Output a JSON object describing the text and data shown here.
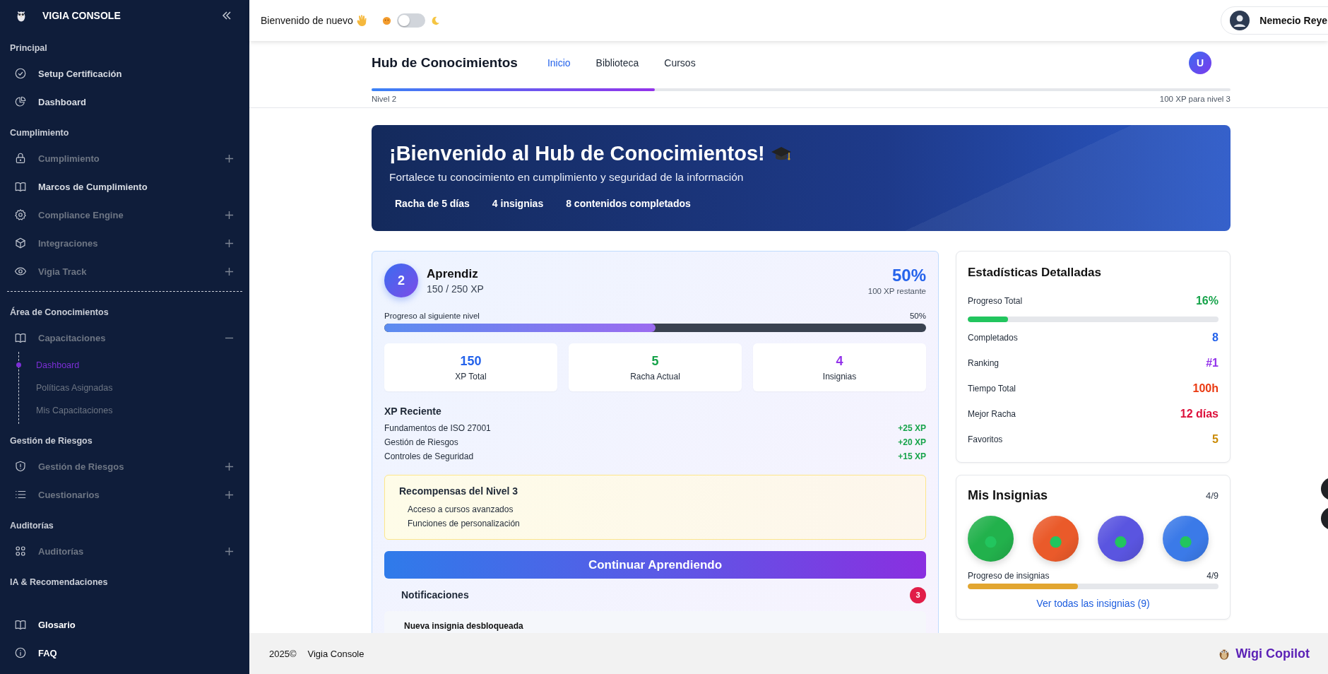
{
  "sidebar": {
    "brand": "VIGIA CONSOLE",
    "sections": [
      {
        "title": "Principal",
        "items": [
          {
            "label": "Setup Certificación"
          },
          {
            "label": "Dashboard"
          }
        ]
      },
      {
        "title": "Cumplimiento",
        "items": [
          {
            "label": "Cumplimiento",
            "expanded": false
          },
          {
            "label": "Marcos de Cumplimiento"
          },
          {
            "label": "Compliance Engine",
            "expanded": false
          },
          {
            "label": "Integraciones",
            "expanded": false
          },
          {
            "label": "Vigia Track",
            "expanded": false
          }
        ]
      },
      {
        "title": "Área de Conocimientos",
        "items": [
          {
            "label": "Capacitaciones",
            "expanded": true,
            "children": [
              {
                "label": "Dashboard",
                "selected": true
              },
              {
                "label": "Políticas Asignadas",
                "selected": false
              },
              {
                "label": "Mis Capacitaciones",
                "selected": false
              }
            ]
          }
        ]
      },
      {
        "title": "Gestión de Riesgos",
        "items": [
          {
            "label": "Gestión de Riesgos",
            "expanded": false
          },
          {
            "label": "Cuestionarios",
            "expanded": false
          }
        ]
      },
      {
        "title": "Auditorías",
        "items": [
          {
            "label": "Auditorías",
            "expanded": false
          }
        ]
      },
      {
        "title": "IA & Recomendaciones"
      }
    ],
    "bottom_links": [
      {
        "label": "Glosario"
      },
      {
        "label": "FAQ"
      }
    ]
  },
  "topbar": {
    "greeting": "Bienvenido de nuevo",
    "dark_mode": false,
    "user": "Nemecio Reye"
  },
  "hub": {
    "title": "Hub de Conocimientos",
    "tabs": [
      {
        "label": "Inicio",
        "selected": true
      },
      {
        "label": "Biblioteca",
        "selected": false
      },
      {
        "label": "Cursos",
        "selected": false
      }
    ],
    "avatar": "U",
    "progress": {
      "level": 0.33
    },
    "left_label": "Nivel 2",
    "right_label": "100 XP para nivel 3"
  },
  "banner": {
    "title": "¡Bienvenido al Hub de Conocimientos!",
    "subtitle": "Fortalece tu conocimiento en cumplimiento y seguridad de la información",
    "stats": [
      "Racha de 5 días",
      "4 insignias",
      "8 contenidos completados"
    ]
  },
  "level_card": {
    "level_number": "2",
    "rank": "Aprendiz",
    "xp": "150 / 250 XP",
    "percent": "50%",
    "remaining": "100 XP restante",
    "progress_label": "Progreso al siguiente nivel",
    "progress_reading": "50%",
    "progress": {
      "level": 0.5
    },
    "tiles": [
      {
        "value": "150",
        "label": "XP Total",
        "color": "#2563eb"
      },
      {
        "value": "5",
        "label": "Racha Actual",
        "color": "#16a34a"
      },
      {
        "value": "4",
        "label": "Insignias",
        "color": "#9333ea"
      }
    ],
    "recent_title": "XP Reciente",
    "recent": [
      {
        "name": "Fundamentos de ISO 27001",
        "xp": "+25 XP"
      },
      {
        "name": "Gestión de Riesgos",
        "xp": "+20 XP"
      },
      {
        "name": "Controles de Seguridad",
        "xp": "+15 XP"
      }
    ],
    "rewards": {
      "title": "Recompensas del Nivel 3",
      "items": [
        "Acceso a cursos avanzados",
        "Funciones de personalización"
      ]
    },
    "button": "Continuar Aprendiendo",
    "notifications": {
      "title": "Notificaciones",
      "count": "3",
      "items": [
        {
          "title": "Nueva insignia desbloqueada"
        }
      ]
    }
  },
  "stats_card": {
    "title": "Estadísticas Detalladas",
    "rows": [
      {
        "kind": "progress",
        "label": "Progreso Total",
        "value": "16%",
        "color": "#16a34a",
        "level": 0.16
      },
      {
        "kind": "count",
        "label": "Completados",
        "value": "8",
        "color": "#2563eb"
      },
      {
        "kind": "count",
        "label": "Ranking",
        "value": "#1",
        "color": "#9333ea"
      },
      {
        "kind": "count",
        "label": "Tiempo Total",
        "value": "100h",
        "color": "#ea3a12"
      },
      {
        "kind": "count",
        "label": "Mejor Racha",
        "value": "12 días",
        "color": "#dc0f3a"
      },
      {
        "kind": "count",
        "label": "Favoritos",
        "value": "5",
        "color": "#ca8a04"
      }
    ]
  },
  "badges_card": {
    "title": "Mis Insignias",
    "count": "4/9",
    "badges": [
      {
        "color": "#22b14c"
      },
      {
        "color": "#ea5a2a"
      },
      {
        "color": "#5a55e0"
      },
      {
        "color": "#3b7ae8"
      }
    ],
    "progress_label": "Progreso de insignias",
    "progress_reading": "4/9",
    "progress": {
      "level": 0.44
    },
    "link": "Ver todas las insignias (9)"
  },
  "footer": {
    "year": "2025©",
    "brand": "Vigia Console",
    "copilot": "Wigi Copilot"
  }
}
